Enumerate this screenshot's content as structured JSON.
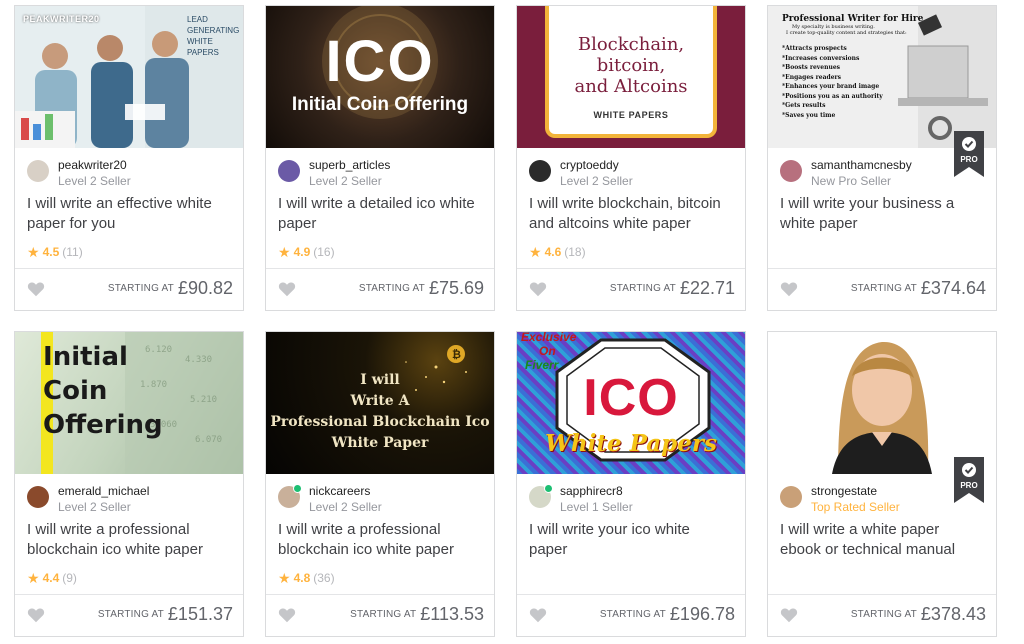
{
  "colors": {
    "star": "#ffb33e",
    "online": "#1dbf73",
    "level_text": "#95979d",
    "top_rated": "#ffb33e"
  },
  "price_prefix": "STARTING AT",
  "gigs": [
    {
      "seller": "peakwriter20",
      "level": "Level 2 Seller",
      "title": "I will write an effective white paper for you",
      "rating": "4.5",
      "reviews": "(11)",
      "price": "£90.82",
      "thumb_text": [
        "PEAKWRITER20",
        "LEAD GENERATING WHITE PAPERS"
      ],
      "online": false,
      "pro": false
    },
    {
      "seller": "superb_articles",
      "level": "Level 2 Seller",
      "title": "I will write a detailed ico white paper",
      "rating": "4.9",
      "reviews": "(16)",
      "price": "£75.69",
      "thumb_text": [
        "ICO",
        "Initial Coin Offering"
      ],
      "online": false,
      "pro": false
    },
    {
      "seller": "cryptoeddy",
      "level": "Level 2 Seller",
      "title": "I will write blockchain, bitcoin and altcoins white paper",
      "rating": "4.6",
      "reviews": "(18)",
      "price": "£22.71",
      "thumb_text": [
        "Blockchain,",
        "bitcoin,",
        "and Altcoins",
        "WHITE PAPERS"
      ],
      "online": false,
      "pro": false
    },
    {
      "seller": "samanthamcnesby",
      "level": "New Pro Seller",
      "title": "I will write your business a white paper",
      "rating": "",
      "reviews": "",
      "price": "£374.64",
      "thumb_text": [
        "Professional Writer for Hire",
        "My specialty is business writing.",
        "I create top-quality content and strategies that:",
        "*Attracts prospects",
        "*Increases conversions",
        "*Boosts revenues",
        "*Engages readers",
        "*Enhances your brand image",
        "*Positions you as an authority",
        "*Gets results",
        "*Saves you time"
      ],
      "online": false,
      "pro": true,
      "pro_label": "PRO"
    },
    {
      "seller": "emerald_michael",
      "level": "Level 2 Seller",
      "title": "I will write a professional blockchain ico white paper",
      "rating": "4.4",
      "reviews": "(9)",
      "price": "£151.37",
      "thumb_text": [
        "I",
        "nitial",
        "C",
        "oin",
        "O",
        "ffering"
      ],
      "online": false,
      "pro": false
    },
    {
      "seller": "nickcareers",
      "level": "Level 2 Seller",
      "title": "I will write a professional blockchain ico white paper",
      "rating": "4.8",
      "reviews": "(36)",
      "price": "£113.53",
      "thumb_text": [
        "I will",
        "Write A",
        "Professional Blockchain Ico",
        "White Paper"
      ],
      "online": true,
      "pro": false
    },
    {
      "seller": "sapphirecr8",
      "level": "Level 1 Seller",
      "title": "I will write your ico white paper",
      "rating": "",
      "reviews": "",
      "price": "£196.78",
      "thumb_text": [
        "Exclusive",
        "On",
        "Fiverr",
        "ICO",
        "White Papers"
      ],
      "online": true,
      "pro": false
    },
    {
      "seller": "strongestate",
      "level": "Top Rated Seller",
      "title": "I will write a white paper ebook or technical manual",
      "rating": "",
      "reviews": "",
      "price": "£378.43",
      "thumb_text": [],
      "online": false,
      "pro": true,
      "pro_label": "PRO"
    }
  ]
}
